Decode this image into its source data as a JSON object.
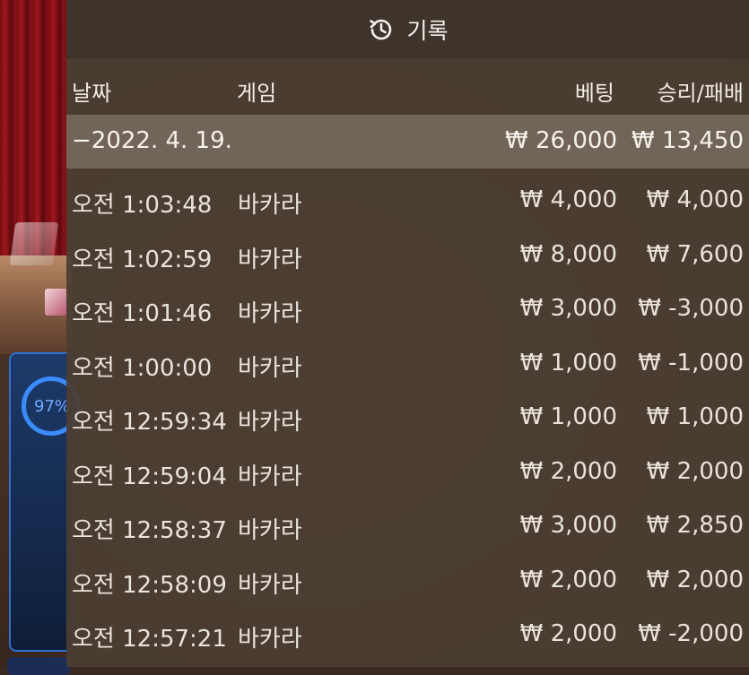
{
  "background": {
    "progress_label": "97%",
    "accent_color": "#3a8bff"
  },
  "header": {
    "icon": "history-icon",
    "title": "기록"
  },
  "columns": {
    "date": "날짜",
    "game": "게임",
    "bet": "베팅",
    "result": "승리/패배"
  },
  "day_group": {
    "date": "−2022. 4. 19.",
    "bet_total": "₩ 26,000",
    "result_total": "₩ 13,450"
  },
  "rows": [
    {
      "time": "오전 1:03:48",
      "game": "바카라",
      "bet": "₩ 4,000",
      "result": "₩ 4,000"
    },
    {
      "time": "오전 1:02:59",
      "game": "바카라",
      "bet": "₩ 8,000",
      "result": "₩ 7,600"
    },
    {
      "time": "오전 1:01:46",
      "game": "바카라",
      "bet": "₩ 3,000",
      "result": "₩ -3,000"
    },
    {
      "time": "오전 1:00:00",
      "game": "바카라",
      "bet": "₩ 1,000",
      "result": "₩ -1,000"
    },
    {
      "time": "오전 12:59:34",
      "game": "바카라",
      "bet": "₩ 1,000",
      "result": "₩ 1,000"
    },
    {
      "time": "오전 12:59:04",
      "game": "바카라",
      "bet": "₩ 2,000",
      "result": "₩ 2,000"
    },
    {
      "time": "오전 12:58:37",
      "game": "바카라",
      "bet": "₩ 3,000",
      "result": "₩ 2,850"
    },
    {
      "time": "오전 12:58:09",
      "game": "바카라",
      "bet": "₩ 2,000",
      "result": "₩ 2,000"
    },
    {
      "time": "오전 12:57:21",
      "game": "바카라",
      "bet": "₩ 2,000",
      "result": "₩ -2,000"
    }
  ]
}
